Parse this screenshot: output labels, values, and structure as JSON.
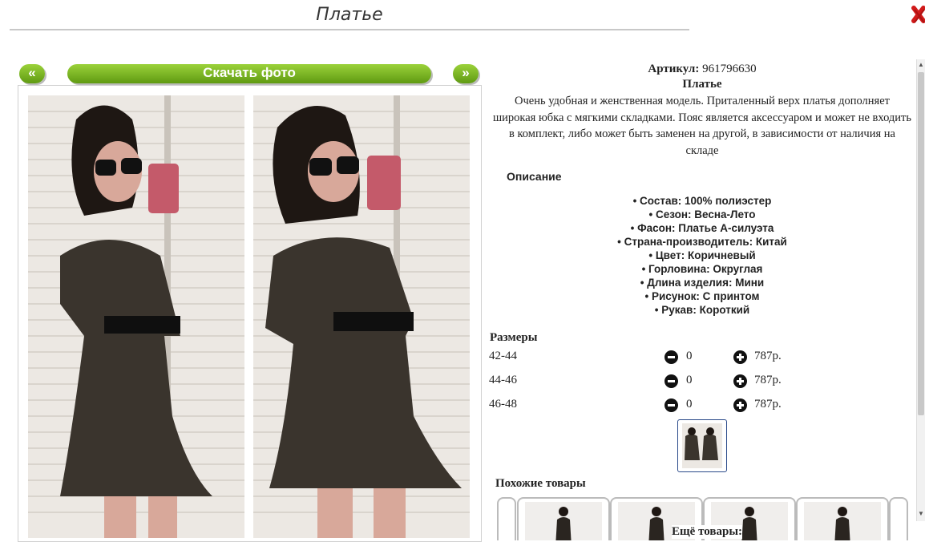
{
  "page": {
    "title": "Платье"
  },
  "gallery": {
    "prev_label": "«",
    "next_label": "»",
    "download_label": "Скачать фото"
  },
  "product": {
    "article_label": "Артикул:",
    "article_value": "961796630",
    "name": "Платье",
    "description": "Очень удобная и женственная модель. Приталенный верх платья дополняет широкая юбка с мягкими складками. Пояс является аксессуаром и может не входить в комплект, либо может быть заменен на другой, в зависимости от наличия на складе",
    "specs_heading": "Описание",
    "specs": [
      "Состав: 100% полиэстер",
      "Сезон: Весна-Лето",
      "Фасон: Платье А-силуэта",
      "Страна-производитель: Китай",
      "Цвет: Коричневый",
      "Горловина: Округлая",
      "Длина изделия: Мини",
      "Рисунок: С принтом",
      "Рукав: Короткий"
    ]
  },
  "sizes": {
    "heading": "Размеры",
    "rows": [
      {
        "size": "42-44",
        "qty": "0",
        "price": "787р."
      },
      {
        "size": "44-46",
        "qty": "0",
        "price": "787р."
      },
      {
        "size": "46-48",
        "qty": "0",
        "price": "787р."
      }
    ]
  },
  "similar": {
    "heading": "Похожие товары"
  },
  "more": {
    "heading": "Ещё товары:"
  },
  "colors": {
    "accent_green": "#6fae1c",
    "close_red": "#d11a1a"
  },
  "icons": {
    "close": "close-x-icon",
    "minus": "minus-circle-icon",
    "plus": "plus-circle-icon"
  }
}
